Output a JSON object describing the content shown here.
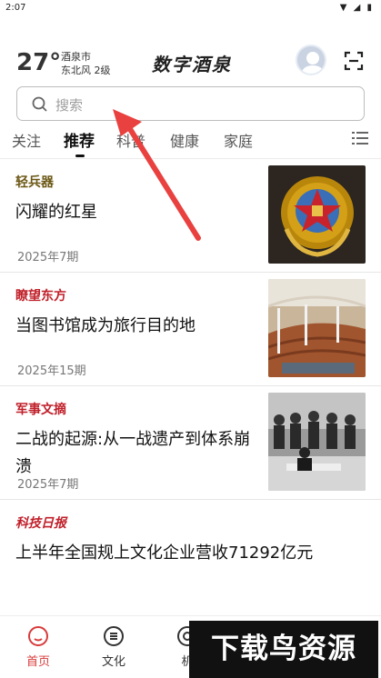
{
  "status_bar": {
    "time": "2:07",
    "icons": "▼ ◢ ▮"
  },
  "weather": {
    "temperature": "27°",
    "city": "酒泉市",
    "wind": "东北风 2级"
  },
  "app": {
    "title": "数字酒泉"
  },
  "search": {
    "placeholder": "搜索"
  },
  "tabs": [
    {
      "label": "关注",
      "active": false
    },
    {
      "label": "推荐",
      "active": true
    },
    {
      "label": "科普",
      "active": false
    },
    {
      "label": "健康",
      "active": false
    },
    {
      "label": "家庭",
      "active": false
    }
  ],
  "articles": [
    {
      "source": "轻兵器",
      "source_color": "#6b5714",
      "title": "闪耀的红星",
      "date": "2025年7期"
    },
    {
      "source": "瞭望东方",
      "source_color": "#c0202a",
      "title": "当图书馆成为旅行目的地",
      "date": "2025年15期"
    },
    {
      "source": "军事文摘",
      "source_color": "#c0202a",
      "title": "二战的起源:从一战遗产到体系崩溃",
      "date": "2025年7期"
    },
    {
      "source": "科技日报",
      "source_color": "#c0202a",
      "title": "上半年全国规上文化企业营收71292亿元",
      "date": ""
    }
  ],
  "bottom_nav": [
    {
      "label": "首页",
      "icon": "home-icon",
      "active": true
    },
    {
      "label": "文化",
      "icon": "culture-icon",
      "active": false
    },
    {
      "label": "机",
      "icon": "robot-icon",
      "active": false
    }
  ],
  "watermark": {
    "text": "下载鸟资源"
  },
  "colors": {
    "accent_red": "#d83a3a",
    "arrow_red": "#e8413f"
  }
}
